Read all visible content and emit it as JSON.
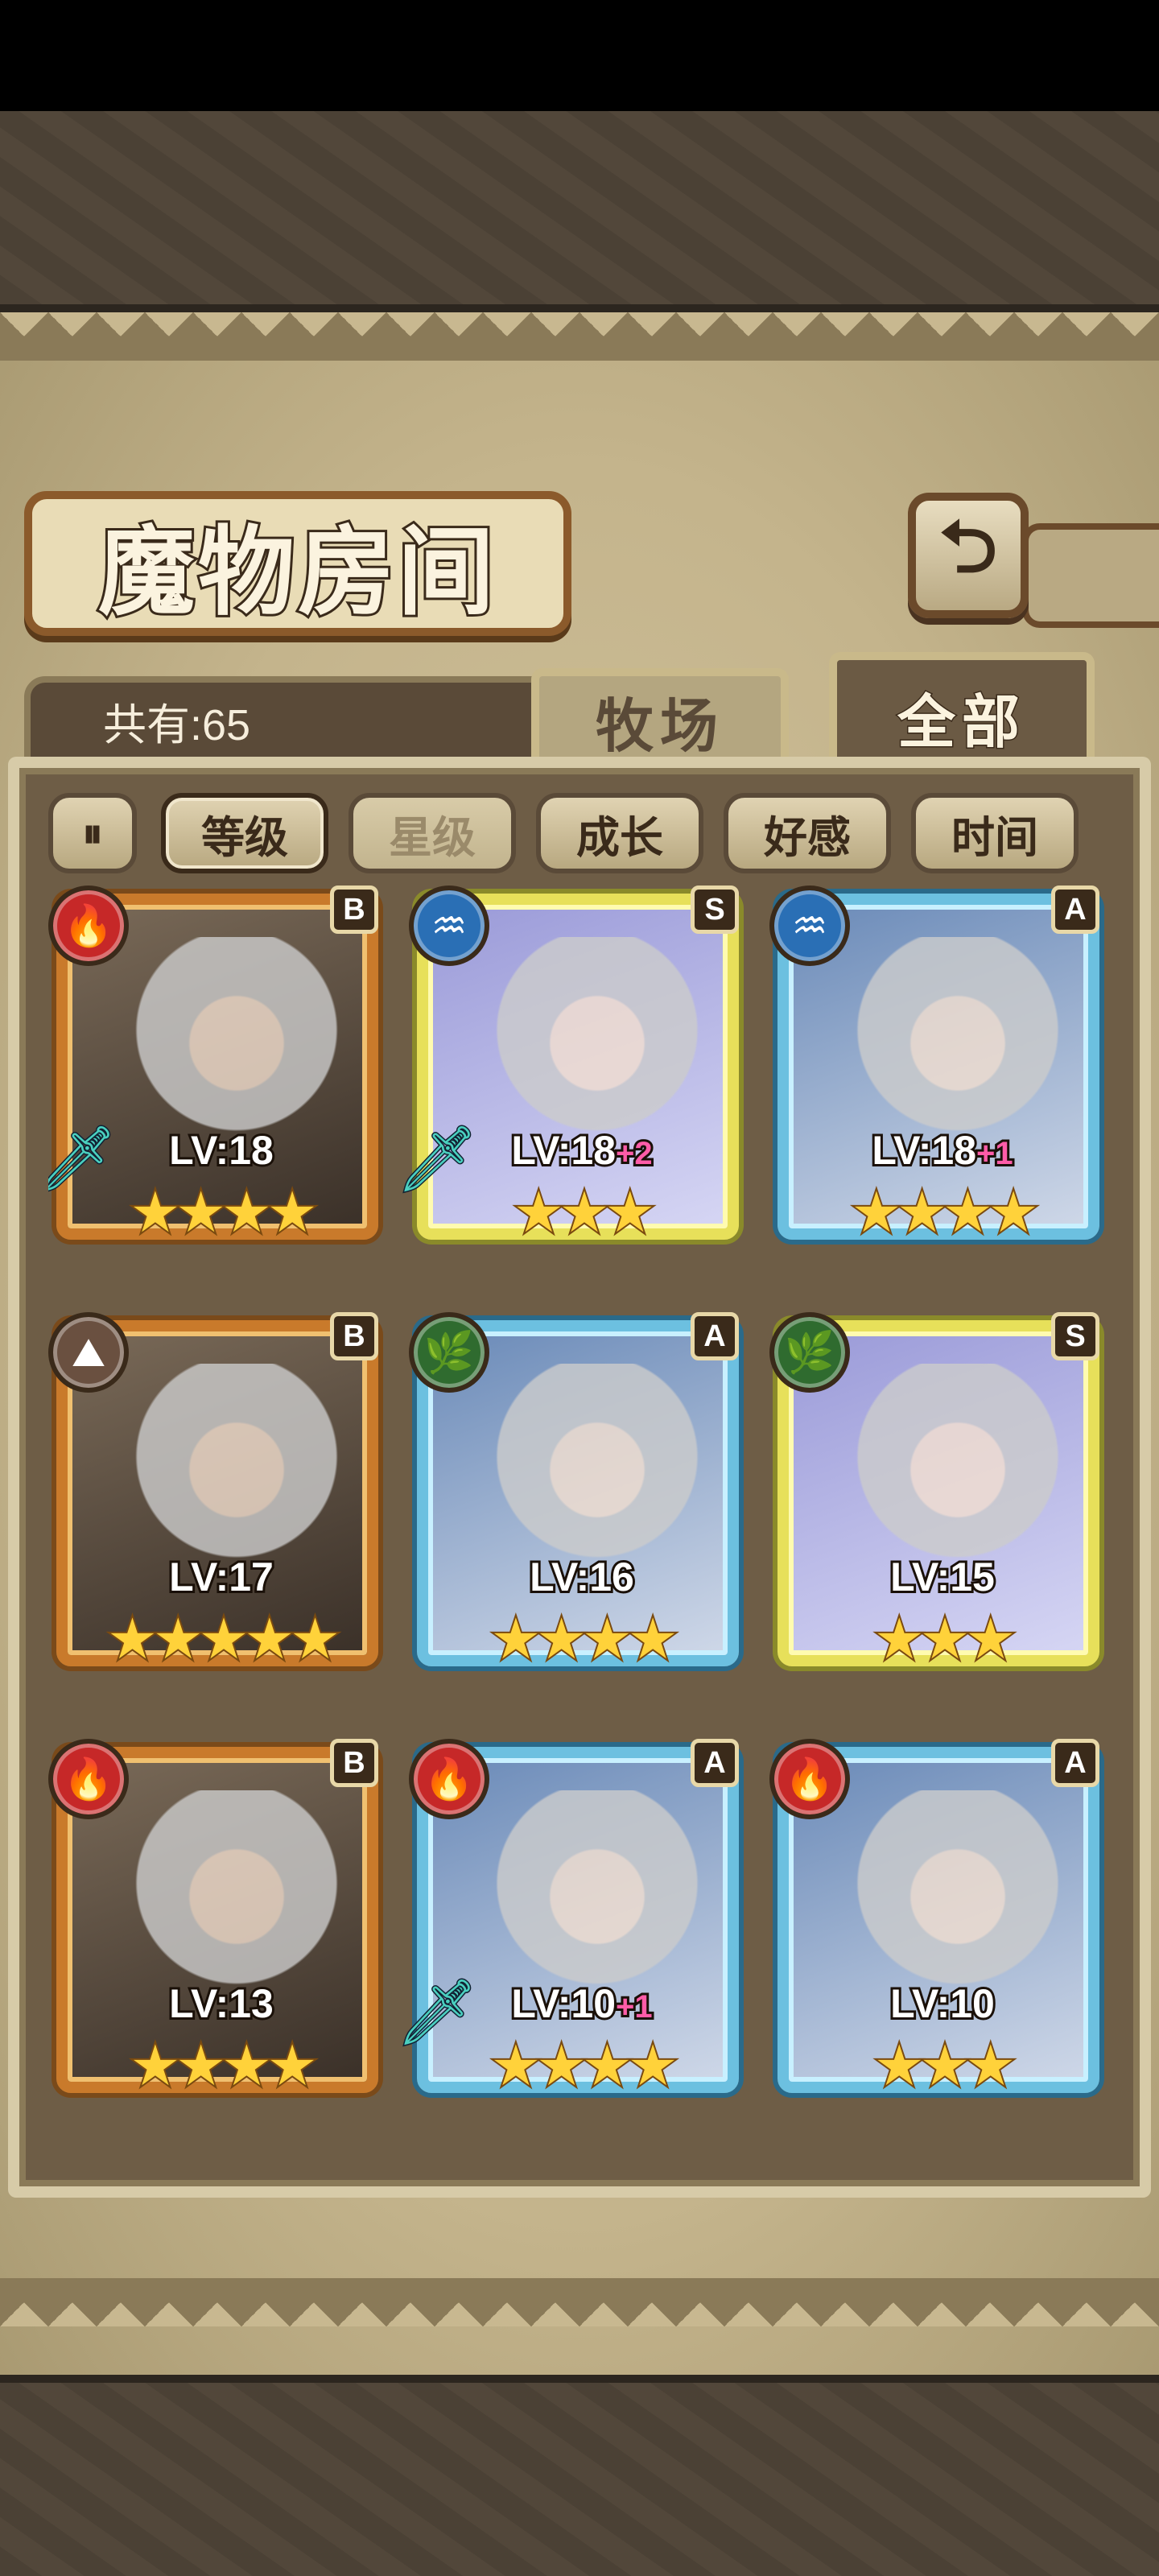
{
  "header": {
    "title": "魔物房间",
    "back_icon": "back-arrow-icon",
    "count_label": "共有:65"
  },
  "tabs": [
    {
      "label": "牧场",
      "active": false
    },
    {
      "label": "全部",
      "active": true
    }
  ],
  "filters": {
    "toggle_icon": "pause-toggle-icon",
    "sort_options": [
      {
        "label": "等级",
        "active": true
      },
      {
        "label": "星级",
        "active": false
      },
      {
        "label": "成长",
        "active": false
      },
      {
        "label": "好感",
        "active": false
      },
      {
        "label": "时间",
        "active": false
      }
    ]
  },
  "monsters": [
    {
      "rarity": "B",
      "element": "fire",
      "level": "LV:18",
      "plus": "",
      "stars": 4,
      "equipped": true
    },
    {
      "rarity": "S",
      "element": "water",
      "level": "LV:18",
      "plus": "+2",
      "stars": 3,
      "equipped": true
    },
    {
      "rarity": "A",
      "element": "water",
      "level": "LV:18",
      "plus": "+1",
      "stars": 4,
      "equipped": false
    },
    {
      "rarity": "B",
      "element": "earth",
      "level": "LV:17",
      "plus": "",
      "stars": 5,
      "equipped": false
    },
    {
      "rarity": "A",
      "element": "leaf",
      "level": "LV:16",
      "plus": "",
      "stars": 4,
      "equipped": false
    },
    {
      "rarity": "S",
      "element": "leaf",
      "level": "LV:15",
      "plus": "",
      "stars": 3,
      "equipped": false
    },
    {
      "rarity": "B",
      "element": "fire",
      "level": "LV:13",
      "plus": "",
      "stars": 4,
      "equipped": false
    },
    {
      "rarity": "A",
      "element": "fire",
      "level": "LV:10",
      "plus": "+1",
      "stars": 4,
      "equipped": true
    },
    {
      "rarity": "A",
      "element": "fire",
      "level": "LV:10",
      "plus": "",
      "stars": 3,
      "equipped": false
    }
  ]
}
